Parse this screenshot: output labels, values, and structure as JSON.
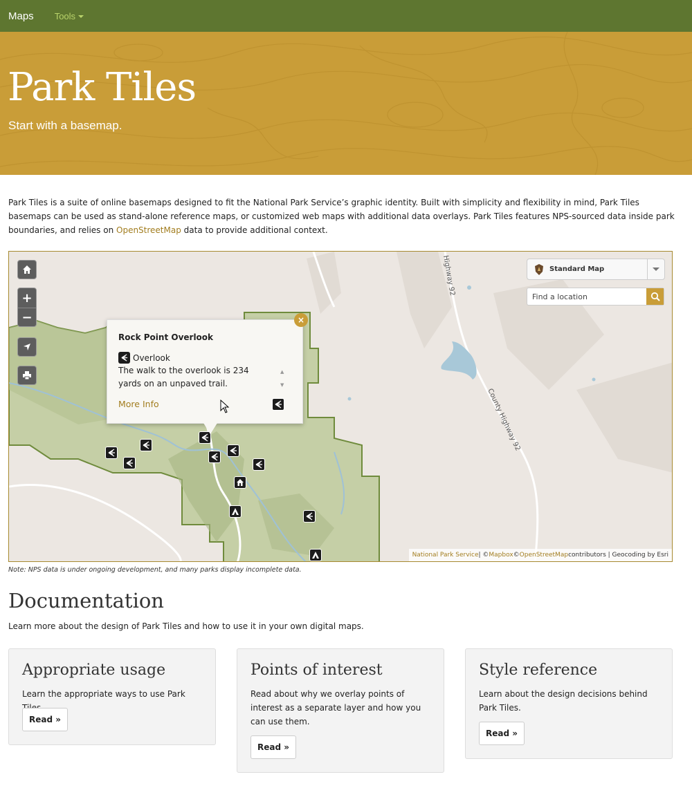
{
  "navbar": {
    "brand": "Maps",
    "tools_label": "Tools"
  },
  "hero": {
    "title": "Park Tiles",
    "subtitle": "Start with a basemap."
  },
  "intro": {
    "text_before_link": "Park Tiles is a suite of online basemaps designed to fit the National Park Service’s graphic identity. Built with simplicity and flexibility in mind, Park Tiles basemaps can be used as stand-alone reference maps, or customized web maps with additional data overlays. Park Tiles features NPS-sourced data inside park boundaries, and relies on ",
    "link": "OpenStreetMap",
    "text_after_link": " data to provide additional context."
  },
  "map": {
    "basemap_selected": "Standard Map",
    "search_placeholder": "Find a location",
    "road_labels": [
      "Highway 92",
      "County Highway 92"
    ],
    "popup": {
      "title": "Rock Point Overlook",
      "type": "Overlook",
      "description": "The walk to the overlook is 234 yards on an unpaved trail.",
      "more_info": "More Info",
      "close": "×"
    },
    "attribution": {
      "nps": "National Park Service",
      "sep1": " | © ",
      "mapbox": "Mapbox",
      "sep2": " © ",
      "osm": "OpenStreetMap",
      "rest": " contributors | Geocoding by Esri"
    },
    "icons": {
      "home": "home-icon",
      "zoom_in": "+",
      "zoom_out": "−",
      "locate": "locate-icon",
      "print": "print-icon"
    },
    "colors": {
      "park": "#c5cfa6",
      "water": "#a8c8d8",
      "accent": "#c99d38"
    }
  },
  "note": "Note: NPS data is under ongoing development, and many parks display incomplete data.",
  "documentation": {
    "title": "Documentation",
    "subtitle": "Learn more about the design of Park Tiles and how to use it in your own digital maps.",
    "cards": [
      {
        "title": "Appropriate usage",
        "text": "Learn the appropriate ways to use Park Tiles.",
        "button": "Read »"
      },
      {
        "title": "Points of interest",
        "text": "Read about why we overlay points of interest as a separate layer and how you can use them.",
        "button": "Read »"
      },
      {
        "title": "Style reference",
        "text": "Learn about the design decisions behind Park Tiles.",
        "button": "Read »"
      }
    ]
  },
  "colors": {
    "navbar": "#5e7630",
    "hero": "#c99d38",
    "link": "#a27d1f"
  }
}
